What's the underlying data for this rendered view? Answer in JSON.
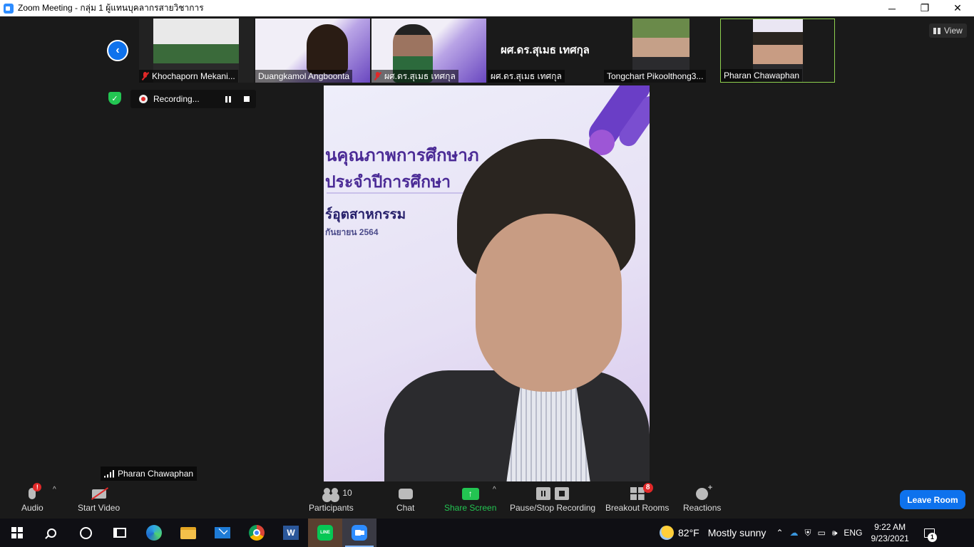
{
  "window": {
    "title": "Zoom Meeting - กลุ่ม 1 ผู้แทนบุคลากรสายวิชาการ",
    "minimize": "─",
    "restore": "❐",
    "close": "✕"
  },
  "view_button": "View",
  "participants_strip": [
    {
      "name": "Khochaporn Mekani...",
      "muted": true
    },
    {
      "name": "Duangkamol Angboonta",
      "muted": false
    },
    {
      "name": "ผศ.ดร.สุเมธ เทศกุล",
      "muted": true
    },
    {
      "name": "ผศ.ดร.สุเมธ เทศกุล",
      "muted": false,
      "video_off": true,
      "display_text": "ผศ.ดร.สุเมธ เทศกุล"
    },
    {
      "name": "Tongchart Pikoolthong3...",
      "muted": false
    },
    {
      "name": "Pharan Chawaphan",
      "muted": false,
      "active_speaker": true
    }
  ],
  "recording": {
    "label": "Recording..."
  },
  "main_video": {
    "speaker_name": "Pharan Chawaphan",
    "slide_lines": [
      "นคุณภาพการศึกษาภ",
      "ประจำปีการศึกษา",
      "ร์อุตสาหกรรม",
      "กันยายน 2564"
    ]
  },
  "toolbar": {
    "audio": "Audio",
    "audio_alert": "!",
    "start_video": "Start Video",
    "participants": "Participants",
    "participants_count": "10",
    "chat": "Chat",
    "share_screen": "Share Screen",
    "pause_stop_recording": "Pause/Stop Recording",
    "breakout_rooms": "Breakout Rooms",
    "breakout_badge": "8",
    "reactions": "Reactions",
    "leave_room": "Leave Room",
    "caret": "^"
  },
  "taskbar": {
    "apps": [
      "windows-start",
      "search",
      "cortana",
      "task-view",
      "edge",
      "file-explorer",
      "mail",
      "chrome",
      "word",
      "line",
      "zoom"
    ],
    "line_label": "LINE",
    "word_label": "W",
    "weather_temp": "82°F",
    "weather_text": "Mostly sunny",
    "language": "ENG",
    "time": "9:22 AM",
    "date": "9/23/2021",
    "notifications": "1"
  },
  "colors": {
    "accent": "#0e72ed",
    "share_green": "#23c552",
    "alert_red": "#e02828",
    "active_speaker_border": "#8fd14f"
  }
}
